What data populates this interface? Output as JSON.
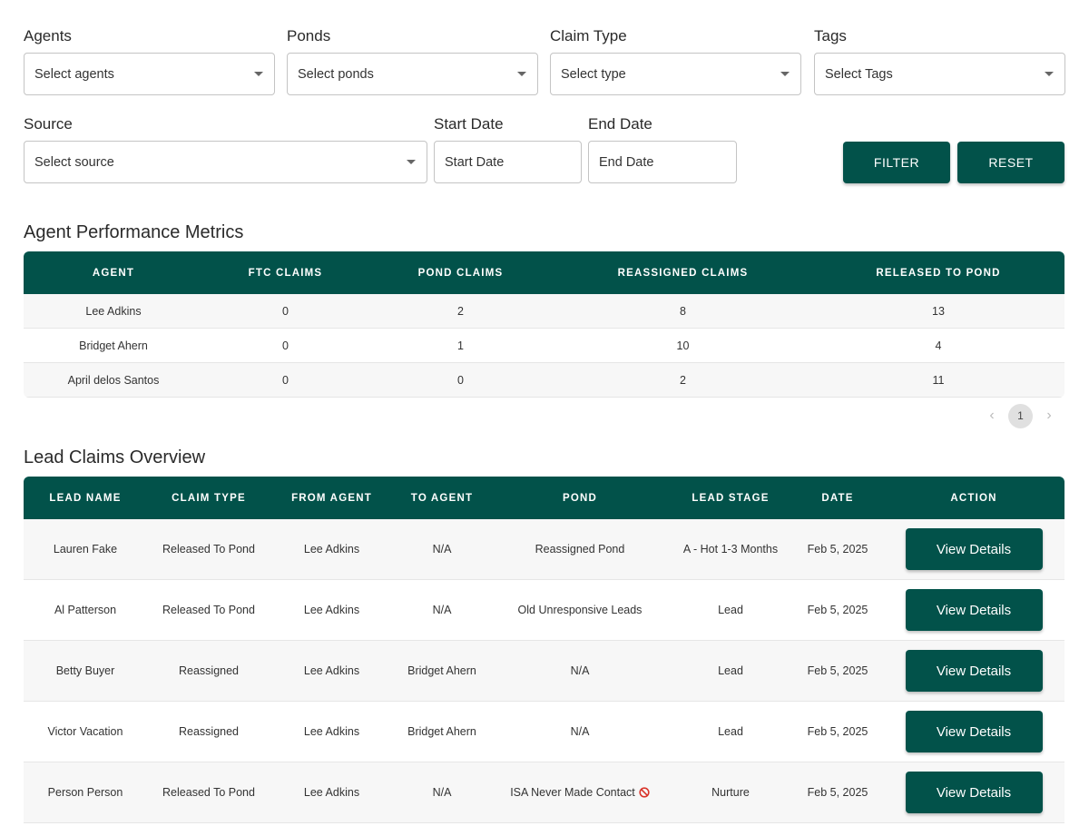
{
  "filters": {
    "agents": {
      "label": "Agents",
      "placeholder": "Select agents"
    },
    "ponds": {
      "label": "Ponds",
      "placeholder": "Select ponds"
    },
    "claim_type": {
      "label": "Claim Type",
      "placeholder": "Select type"
    },
    "tags": {
      "label": "Tags",
      "placeholder": "Select Tags"
    },
    "source": {
      "label": "Source",
      "placeholder": "Select source"
    },
    "start_date": {
      "label": "Start Date",
      "placeholder": "Start Date"
    },
    "end_date": {
      "label": "End Date",
      "placeholder": "End Date"
    },
    "filter_label": "FILTER",
    "reset_label": "RESET"
  },
  "metrics": {
    "title": "Agent Performance Metrics",
    "columns": [
      "AGENT",
      "FTC CLAIMS",
      "POND CLAIMS",
      "REASSIGNED CLAIMS",
      "RELEASED TO POND"
    ],
    "rows": [
      [
        "Lee Adkins",
        "0",
        "2",
        "8",
        "13"
      ],
      [
        "Bridget Ahern",
        "0",
        "1",
        "10",
        "4"
      ],
      [
        "April delos Santos",
        "0",
        "0",
        "2",
        "11"
      ]
    ],
    "pagination": {
      "prev": "‹",
      "page": "1",
      "next": "›"
    }
  },
  "claims": {
    "title": "Lead Claims Overview",
    "columns": [
      "LEAD NAME",
      "CLAIM TYPE",
      "FROM AGENT",
      "TO AGENT",
      "POND",
      "LEAD STAGE",
      "DATE",
      "ACTION"
    ],
    "action_label": "View Details",
    "rows": [
      [
        "Lauren Fake",
        "Released To Pond",
        "Lee Adkins",
        "N/A",
        "Reassigned Pond",
        "A - Hot 1-3 Months",
        "Feb 5, 2025"
      ],
      [
        "Al Patterson",
        "Released To Pond",
        "Lee Adkins",
        "N/A",
        "Old Unresponsive Leads",
        "Lead",
        "Feb 5, 2025"
      ],
      [
        "Betty Buyer",
        "Reassigned",
        "Lee Adkins",
        "Bridget Ahern",
        "N/A",
        "Lead",
        "Feb 5, 2025"
      ],
      [
        "Victor Vacation",
        "Reassigned",
        "Lee Adkins",
        "Bridget Ahern",
        "N/A",
        "Lead",
        "Feb 5, 2025"
      ],
      [
        "Person Person",
        "Released To Pond",
        "Lee Adkins",
        "N/A",
        "ISA Never Made Contact",
        "Nurture",
        "Feb 5, 2025"
      ]
    ],
    "pond_icon_row": 4
  },
  "colors": {
    "accent": "#02524a",
    "no_icon": "#d9352b"
  }
}
